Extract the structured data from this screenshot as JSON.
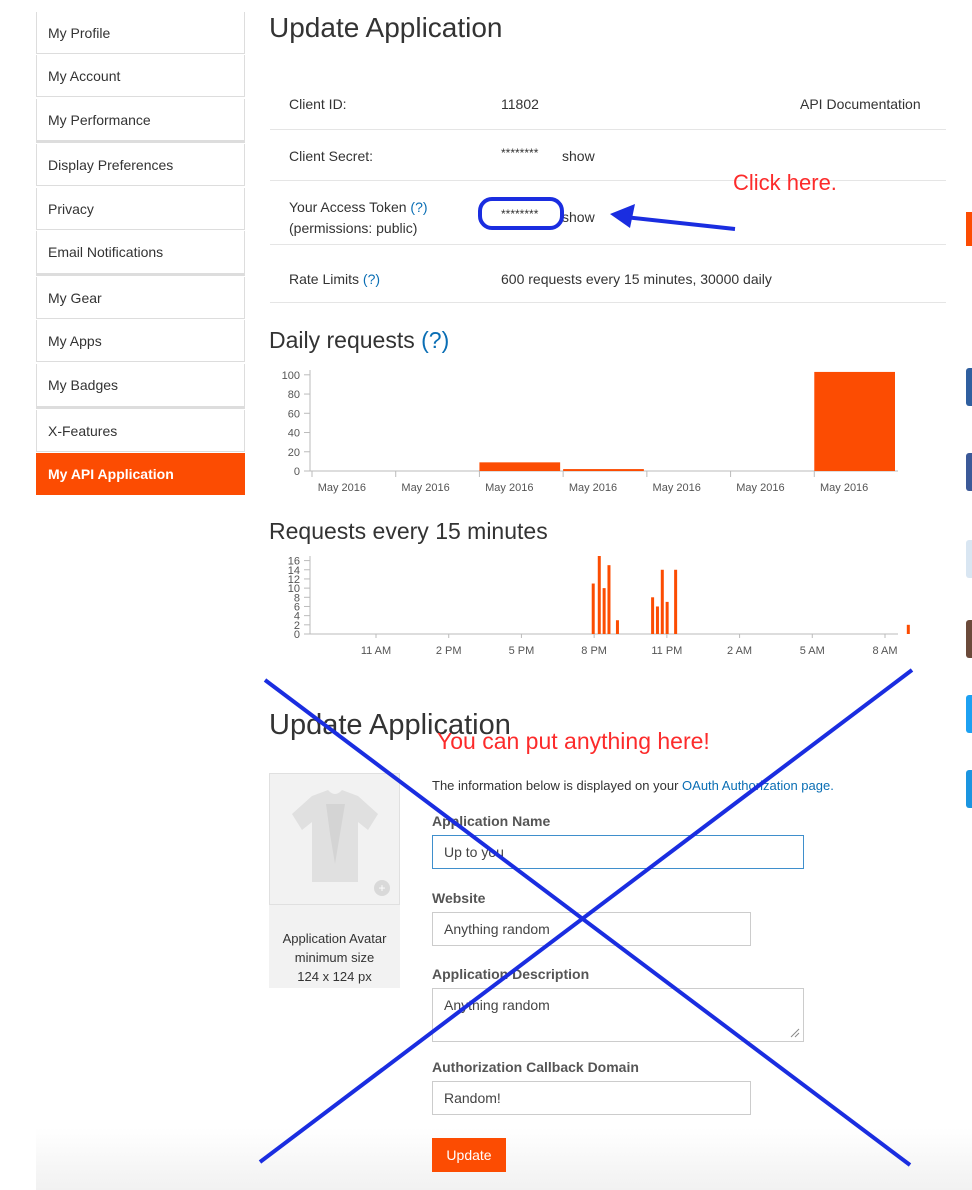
{
  "sidebar": {
    "items": [
      {
        "label": "My Profile"
      },
      {
        "label": "My Account"
      },
      {
        "label": "My Performance"
      },
      {
        "label": "Display Preferences"
      },
      {
        "label": "Privacy"
      },
      {
        "label": "Email Notifications"
      },
      {
        "label": "My Gear"
      },
      {
        "label": "My Apps"
      },
      {
        "label": "My Badges"
      },
      {
        "label": "X-Features"
      },
      {
        "label": "My API Application"
      }
    ]
  },
  "top_title": "Update Application",
  "api_info": {
    "client_id_label": "Client ID:",
    "client_id_value": "11802",
    "api_doc_link": "API Documentation",
    "client_secret_label": "Client Secret:",
    "client_secret_value": "********",
    "show_label": "show",
    "access_token_label": "Your Access Token",
    "help_marker": "(?)",
    "permissions_label": "(permissions: public)",
    "access_token_value": "********",
    "rate_limits_label": "Rate Limits",
    "rate_limits_value": "600 requests every 15 minutes, 30000 daily"
  },
  "annotations": {
    "click_here": "Click here.",
    "put_anything": "You can put anything here!",
    "accent_color": "#fc2b2b",
    "arrow_color": "#1a2de0"
  },
  "daily_chart_title": "Daily requests",
  "daily_help": "(?)",
  "quarter_chart_title": "Requests every 15 minutes",
  "chart_data": [
    {
      "type": "bar",
      "title": "Daily requests",
      "categories": [
        "May 2016",
        "May 2016",
        "May 2016",
        "May 2016",
        "May 2016",
        "May 2016",
        "May 2016"
      ],
      "values": [
        0,
        0,
        9,
        2,
        0,
        0,
        103
      ],
      "y_ticks": [
        "100",
        "80",
        "60",
        "40",
        "20",
        "0"
      ],
      "ylim": [
        0,
        105
      ],
      "color": "#fc4c02"
    },
    {
      "type": "bar",
      "title": "Requests every 15 minutes",
      "x_ticks": [
        "11 AM",
        "2 PM",
        "5 PM",
        "8 PM",
        "11 PM",
        "2 AM",
        "5 AM",
        "8 AM"
      ],
      "y_ticks": [
        "16",
        "14",
        "12",
        "10",
        "8",
        "6",
        "4",
        "2",
        "0"
      ],
      "ylim": [
        0,
        17
      ],
      "bars_hours": [
        {
          "t": 19.9,
          "v": 11
        },
        {
          "t": 20.15,
          "v": 17
        },
        {
          "t": 20.35,
          "v": 10
        },
        {
          "t": 20.55,
          "v": 15
        },
        {
          "t": 20.9,
          "v": 3
        },
        {
          "t": 22.35,
          "v": 8
        },
        {
          "t": 22.55,
          "v": 6
        },
        {
          "t": 22.75,
          "v": 14
        },
        {
          "t": 22.95,
          "v": 7
        },
        {
          "t": 23.3,
          "v": 14
        },
        {
          "t": 32.9,
          "v": 2
        }
      ],
      "color": "#fc4c02"
    }
  ],
  "form": {
    "title": "Update Application",
    "intro_text": "The information below is displayed on your",
    "intro_link": "OAuth Authorization page.",
    "avatar_caption_1": "Application Avatar",
    "avatar_caption_2": "minimum size",
    "avatar_caption_3": "124 x 124 px",
    "app_name_label": "Application Name",
    "app_name_value": "Up to you",
    "website_label": "Website",
    "website_value": "Anything random",
    "description_label": "Application Description",
    "description_value": "Anything random",
    "callback_label": "Authorization Callback Domain",
    "callback_value": "Random!",
    "update_button": "Update"
  }
}
